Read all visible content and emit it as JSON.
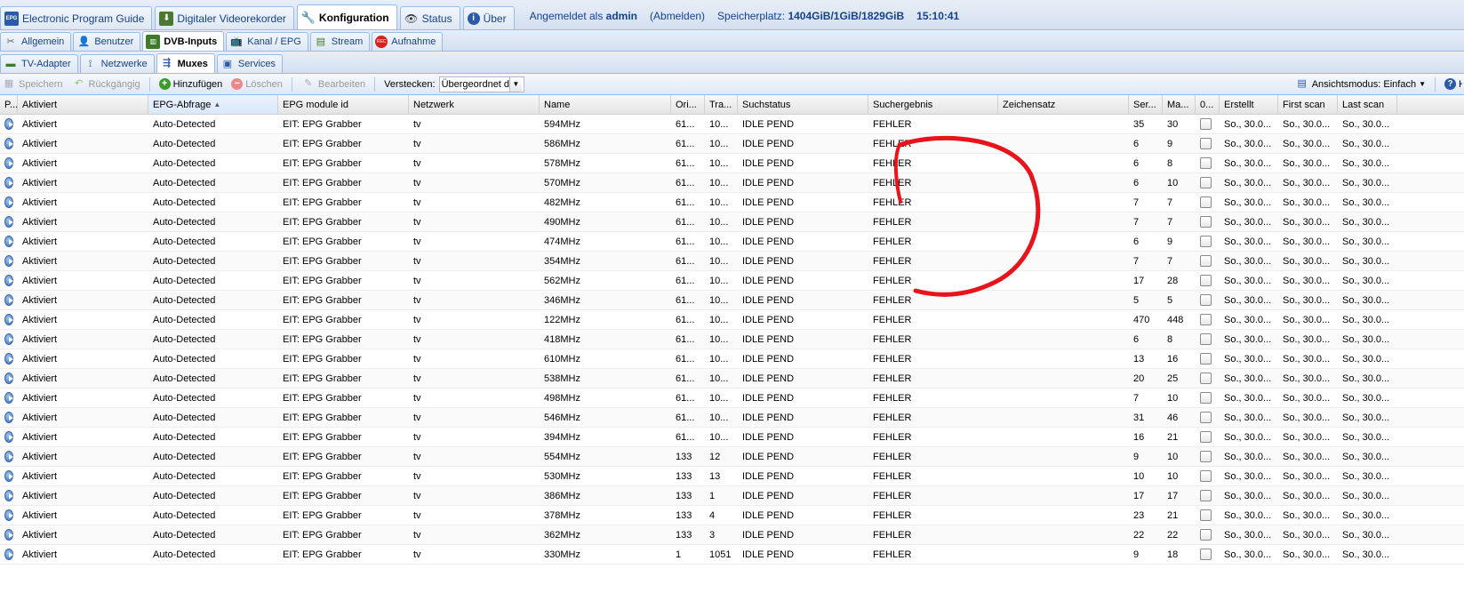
{
  "top_tabs": [
    {
      "label": "Electronic Program Guide",
      "icon": "epg-icon",
      "active": false
    },
    {
      "label": "Digitaler Videorekorder",
      "icon": "dvr-icon",
      "active": false
    },
    {
      "label": "Konfiguration",
      "icon": "wrench-icon",
      "active": true
    },
    {
      "label": "Status",
      "icon": "eye-icon",
      "active": false
    },
    {
      "label": "Über",
      "icon": "info-icon",
      "active": false
    }
  ],
  "status": {
    "logged_in_prefix": "Angemeldet als",
    "user": "admin",
    "logout": "(Abmelden)",
    "storage_label": "Speicherplatz:",
    "storage_value": "1404GiB/1GiB/1829GiB",
    "time": "15:10:41"
  },
  "config_tabs": [
    {
      "label": "Allgemein",
      "icon": "tools-icon",
      "active": false
    },
    {
      "label": "Benutzer",
      "icon": "user-icon",
      "active": false
    },
    {
      "label": "DVB-Inputs",
      "icon": "dvb-card-icon",
      "active": true
    },
    {
      "label": "Kanal / EPG",
      "icon": "tv-icon",
      "active": false
    },
    {
      "label": "Stream",
      "icon": "stream-icon",
      "active": false
    },
    {
      "label": "Aufnahme",
      "icon": "rec-icon",
      "active": false
    }
  ],
  "dvb_tabs": [
    {
      "label": "TV-Adapter",
      "icon": "adapter-icon",
      "active": false
    },
    {
      "label": "Netzwerke",
      "icon": "antenna-icon",
      "active": false
    },
    {
      "label": "Muxes",
      "icon": "mux-icon",
      "active": true
    },
    {
      "label": "Services",
      "icon": "services-icon",
      "active": false
    }
  ],
  "toolbar": {
    "save": "Speichern",
    "undo": "Rückgängig",
    "add": "Hinzufügen",
    "delete": "Löschen",
    "edit": "Bearbeiten",
    "hide_label": "Verstecken:",
    "hide_value": "Übergeordnet d",
    "view_mode": "Ansichtsmodus: Einfach",
    "help": "H"
  },
  "columns": [
    "P...",
    "Aktiviert",
    "EPG-Abfrage",
    "EPG module id",
    "Netzwerk",
    "Name",
    "Ori...",
    "Tra...",
    "Suchstatus",
    "Suchergebnis",
    "Zeichensatz",
    "Ser...",
    "Ma...",
    "0...",
    "Erstellt",
    "First scan",
    "Last scan"
  ],
  "rows": [
    {
      "enabled": "Aktiviert",
      "epg": "Auto-Detected",
      "module": "EIT: EPG Grabber",
      "network": "tv",
      "name": "594MHz",
      "orig": "61...",
      "tra": "10...",
      "status": "IDLE PEND",
      "result": "FEHLER",
      "charset": "",
      "services": "35",
      "ma": "30",
      "created": "So., 30.0...",
      "first": "So., 30.0...",
      "last": "So., 30.0..."
    },
    {
      "enabled": "Aktiviert",
      "epg": "Auto-Detected",
      "module": "EIT: EPG Grabber",
      "network": "tv",
      "name": "586MHz",
      "orig": "61...",
      "tra": "10...",
      "status": "IDLE PEND",
      "result": "FEHLER",
      "charset": "",
      "services": "6",
      "ma": "9",
      "created": "So., 30.0...",
      "first": "So., 30.0...",
      "last": "So., 30.0..."
    },
    {
      "enabled": "Aktiviert",
      "epg": "Auto-Detected",
      "module": "EIT: EPG Grabber",
      "network": "tv",
      "name": "578MHz",
      "orig": "61...",
      "tra": "10...",
      "status": "IDLE PEND",
      "result": "FEHLER",
      "charset": "",
      "services": "6",
      "ma": "8",
      "created": "So., 30.0...",
      "first": "So., 30.0...",
      "last": "So., 30.0..."
    },
    {
      "enabled": "Aktiviert",
      "epg": "Auto-Detected",
      "module": "EIT: EPG Grabber",
      "network": "tv",
      "name": "570MHz",
      "orig": "61...",
      "tra": "10...",
      "status": "IDLE PEND",
      "result": "FEHLER",
      "charset": "",
      "services": "6",
      "ma": "10",
      "created": "So., 30.0...",
      "first": "So., 30.0...",
      "last": "So., 30.0..."
    },
    {
      "enabled": "Aktiviert",
      "epg": "Auto-Detected",
      "module": "EIT: EPG Grabber",
      "network": "tv",
      "name": "482MHz",
      "orig": "61...",
      "tra": "10...",
      "status": "IDLE PEND",
      "result": "FEHLER",
      "charset": "",
      "services": "7",
      "ma": "7",
      "created": "So., 30.0...",
      "first": "So., 30.0...",
      "last": "So., 30.0..."
    },
    {
      "enabled": "Aktiviert",
      "epg": "Auto-Detected",
      "module": "EIT: EPG Grabber",
      "network": "tv",
      "name": "490MHz",
      "orig": "61...",
      "tra": "10...",
      "status": "IDLE PEND",
      "result": "FEHLER",
      "charset": "",
      "services": "7",
      "ma": "7",
      "created": "So., 30.0...",
      "first": "So., 30.0...",
      "last": "So., 30.0..."
    },
    {
      "enabled": "Aktiviert",
      "epg": "Auto-Detected",
      "module": "EIT: EPG Grabber",
      "network": "tv",
      "name": "474MHz",
      "orig": "61...",
      "tra": "10...",
      "status": "IDLE PEND",
      "result": "FEHLER",
      "charset": "",
      "services": "6",
      "ma": "9",
      "created": "So., 30.0...",
      "first": "So., 30.0...",
      "last": "So., 30.0..."
    },
    {
      "enabled": "Aktiviert",
      "epg": "Auto-Detected",
      "module": "EIT: EPG Grabber",
      "network": "tv",
      "name": "354MHz",
      "orig": "61...",
      "tra": "10...",
      "status": "IDLE PEND",
      "result": "FEHLER",
      "charset": "",
      "services": "7",
      "ma": "7",
      "created": "So., 30.0...",
      "first": "So., 30.0...",
      "last": "So., 30.0..."
    },
    {
      "enabled": "Aktiviert",
      "epg": "Auto-Detected",
      "module": "EIT: EPG Grabber",
      "network": "tv",
      "name": "562MHz",
      "orig": "61...",
      "tra": "10...",
      "status": "IDLE PEND",
      "result": "FEHLER",
      "charset": "",
      "services": "17",
      "ma": "28",
      "created": "So., 30.0...",
      "first": "So., 30.0...",
      "last": "So., 30.0..."
    },
    {
      "enabled": "Aktiviert",
      "epg": "Auto-Detected",
      "module": "EIT: EPG Grabber",
      "network": "tv",
      "name": "346MHz",
      "orig": "61...",
      "tra": "10...",
      "status": "IDLE PEND",
      "result": "FEHLER",
      "charset": "",
      "services": "5",
      "ma": "5",
      "created": "So., 30.0...",
      "first": "So., 30.0...",
      "last": "So., 30.0..."
    },
    {
      "enabled": "Aktiviert",
      "epg": "Auto-Detected",
      "module": "EIT: EPG Grabber",
      "network": "tv",
      "name": "122MHz",
      "orig": "61...",
      "tra": "10...",
      "status": "IDLE PEND",
      "result": "FEHLER",
      "charset": "",
      "services": "470",
      "ma": "448",
      "created": "So., 30.0...",
      "first": "So., 30.0...",
      "last": "So., 30.0..."
    },
    {
      "enabled": "Aktiviert",
      "epg": "Auto-Detected",
      "module": "EIT: EPG Grabber",
      "network": "tv",
      "name": "418MHz",
      "orig": "61...",
      "tra": "10...",
      "status": "IDLE PEND",
      "result": "FEHLER",
      "charset": "",
      "services": "6",
      "ma": "8",
      "created": "So., 30.0...",
      "first": "So., 30.0...",
      "last": "So., 30.0..."
    },
    {
      "enabled": "Aktiviert",
      "epg": "Auto-Detected",
      "module": "EIT: EPG Grabber",
      "network": "tv",
      "name": "610MHz",
      "orig": "61...",
      "tra": "10...",
      "status": "IDLE PEND",
      "result": "FEHLER",
      "charset": "",
      "services": "13",
      "ma": "16",
      "created": "So., 30.0...",
      "first": "So., 30.0...",
      "last": "So., 30.0..."
    },
    {
      "enabled": "Aktiviert",
      "epg": "Auto-Detected",
      "module": "EIT: EPG Grabber",
      "network": "tv",
      "name": "538MHz",
      "orig": "61...",
      "tra": "10...",
      "status": "IDLE PEND",
      "result": "FEHLER",
      "charset": "",
      "services": "20",
      "ma": "25",
      "created": "So., 30.0...",
      "first": "So., 30.0...",
      "last": "So., 30.0..."
    },
    {
      "enabled": "Aktiviert",
      "epg": "Auto-Detected",
      "module": "EIT: EPG Grabber",
      "network": "tv",
      "name": "498MHz",
      "orig": "61...",
      "tra": "10...",
      "status": "IDLE PEND",
      "result": "FEHLER",
      "charset": "",
      "services": "7",
      "ma": "10",
      "created": "So., 30.0...",
      "first": "So., 30.0...",
      "last": "So., 30.0..."
    },
    {
      "enabled": "Aktiviert",
      "epg": "Auto-Detected",
      "module": "EIT: EPG Grabber",
      "network": "tv",
      "name": "546MHz",
      "orig": "61...",
      "tra": "10...",
      "status": "IDLE PEND",
      "result": "FEHLER",
      "charset": "",
      "services": "31",
      "ma": "46",
      "created": "So., 30.0...",
      "first": "So., 30.0...",
      "last": "So., 30.0..."
    },
    {
      "enabled": "Aktiviert",
      "epg": "Auto-Detected",
      "module": "EIT: EPG Grabber",
      "network": "tv",
      "name": "394MHz",
      "orig": "61...",
      "tra": "10...",
      "status": "IDLE PEND",
      "result": "FEHLER",
      "charset": "",
      "services": "16",
      "ma": "21",
      "created": "So., 30.0...",
      "first": "So., 30.0...",
      "last": "So., 30.0..."
    },
    {
      "enabled": "Aktiviert",
      "epg": "Auto-Detected",
      "module": "EIT: EPG Grabber",
      "network": "tv",
      "name": "554MHz",
      "orig": "133",
      "tra": "12",
      "status": "IDLE PEND",
      "result": "FEHLER",
      "charset": "",
      "services": "9",
      "ma": "10",
      "created": "So., 30.0...",
      "first": "So., 30.0...",
      "last": "So., 30.0..."
    },
    {
      "enabled": "Aktiviert",
      "epg": "Auto-Detected",
      "module": "EIT: EPG Grabber",
      "network": "tv",
      "name": "530MHz",
      "orig": "133",
      "tra": "13",
      "status": "IDLE PEND",
      "result": "FEHLER",
      "charset": "",
      "services": "10",
      "ma": "10",
      "created": "So., 30.0...",
      "first": "So., 30.0...",
      "last": "So., 30.0..."
    },
    {
      "enabled": "Aktiviert",
      "epg": "Auto-Detected",
      "module": "EIT: EPG Grabber",
      "network": "tv",
      "name": "386MHz",
      "orig": "133",
      "tra": "1",
      "status": "IDLE PEND",
      "result": "FEHLER",
      "charset": "",
      "services": "17",
      "ma": "17",
      "created": "So., 30.0...",
      "first": "So., 30.0...",
      "last": "So., 30.0..."
    },
    {
      "enabled": "Aktiviert",
      "epg": "Auto-Detected",
      "module": "EIT: EPG Grabber",
      "network": "tv",
      "name": "378MHz",
      "orig": "133",
      "tra": "4",
      "status": "IDLE PEND",
      "result": "FEHLER",
      "charset": "",
      "services": "23",
      "ma": "21",
      "created": "So., 30.0...",
      "first": "So., 30.0...",
      "last": "So., 30.0..."
    },
    {
      "enabled": "Aktiviert",
      "epg": "Auto-Detected",
      "module": "EIT: EPG Grabber",
      "network": "tv",
      "name": "362MHz",
      "orig": "133",
      "tra": "3",
      "status": "IDLE PEND",
      "result": "FEHLER",
      "charset": "",
      "services": "22",
      "ma": "22",
      "created": "So., 30.0...",
      "first": "So., 30.0...",
      "last": "So., 30.0..."
    },
    {
      "enabled": "Aktiviert",
      "epg": "Auto-Detected",
      "module": "EIT: EPG Grabber",
      "network": "tv",
      "name": "330MHz",
      "orig": "1",
      "tra": "1051",
      "status": "IDLE PEND",
      "result": "FEHLER",
      "charset": "",
      "services": "9",
      "ma": "18",
      "created": "So., 30.0...",
      "first": "So., 30.0...",
      "last": "So., 30.0..."
    }
  ],
  "colors": {
    "tab_text": "#15428b",
    "border": "#99bbe8",
    "annotation": "#e8141c"
  }
}
